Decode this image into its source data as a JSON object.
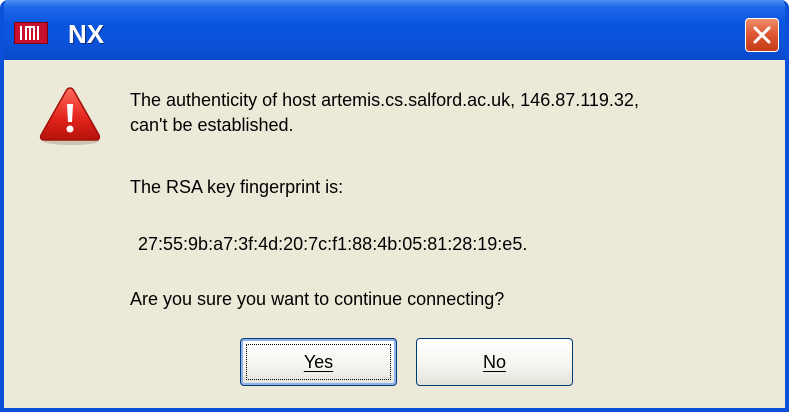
{
  "window": {
    "title": "NX",
    "app_icon": "nx-app-icon",
    "close_icon": "close-icon"
  },
  "dialog": {
    "icon": "warning-icon",
    "host_message_line1": "The authenticity of host artemis.cs.salford.ac.uk, 146.87.119.32,",
    "host_message_line2": "can't be established.",
    "fingerprint_label": "The RSA key fingerprint is:",
    "fingerprint": "27:55:9b:a7:3f:4d:20:7c:f1:88:4b:05:81:28:19:e5.",
    "question": "Are you sure you want to continue connecting?",
    "yes_label": "Yes",
    "no_label": "No"
  },
  "colors": {
    "titlebar": "#0a55e0",
    "dialog_bg": "#ece9d8",
    "warning_red": "#e2231a",
    "close_red": "#df5a36"
  }
}
